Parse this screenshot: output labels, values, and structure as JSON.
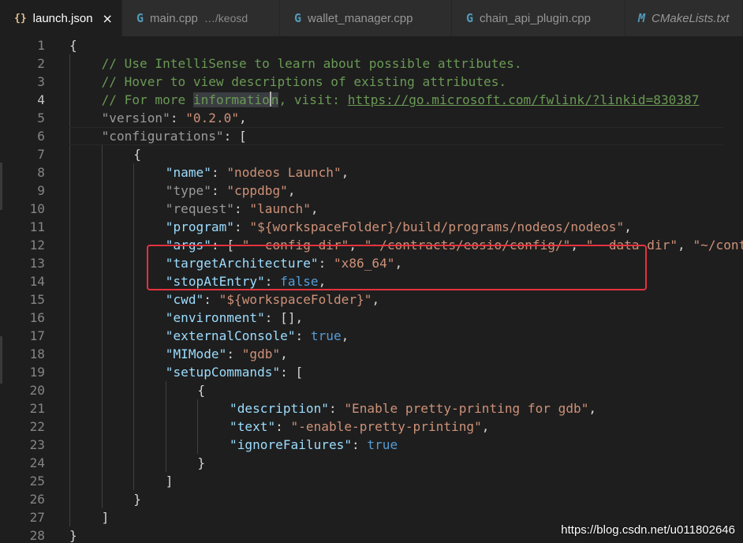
{
  "tabs": [
    {
      "icon": "{}",
      "label": "launch.json",
      "close": "×",
      "active": true
    },
    {
      "icon": "G",
      "label": "main.cpp",
      "description": "…/keosd"
    },
    {
      "icon": "G",
      "label": "wallet_manager.cpp"
    },
    {
      "icon": "G",
      "label": "chain_api_plugin.cpp"
    },
    {
      "icon": "M",
      "label": "CMakeLists.txt"
    }
  ],
  "editor": {
    "line_numbers": [
      "1",
      "2",
      "3",
      "4",
      "5",
      "6",
      "7",
      "8",
      "9",
      "10",
      "11",
      "12",
      "13",
      "14",
      "15",
      "16",
      "17",
      "18",
      "19",
      "20",
      "21",
      "22",
      "23",
      "24",
      "25",
      "26",
      "27",
      "28"
    ],
    "lines": [
      [
        {
          "c": "p",
          "t": "{"
        }
      ],
      [
        {
          "c": "c",
          "t": "// Use IntelliSense to learn about possible attributes."
        }
      ],
      [
        {
          "c": "c",
          "t": "// Hover to view descriptions of existing attributes."
        }
      ],
      [
        {
          "c": "c",
          "t": "// For more "
        },
        {
          "c": "c-hl",
          "t": "informatio"
        },
        {
          "c": "cursor",
          "t": ""
        },
        {
          "c": "c-hl",
          "t": "n"
        },
        {
          "c": "c",
          "t": ", visit: "
        },
        {
          "c": "link",
          "t": "https://go.microsoft.com/fwlink/?linkid=830387"
        }
      ],
      [
        {
          "c": "kd",
          "t": "\"version\""
        },
        {
          "c": "p",
          "t": ": "
        },
        {
          "c": "s",
          "t": "\"0.2.0\""
        },
        {
          "c": "p",
          "t": ","
        }
      ],
      [
        {
          "c": "kd",
          "t": "\"configurations\""
        },
        {
          "c": "p",
          "t": ": ["
        }
      ],
      [
        {
          "c": "p",
          "t": "{"
        }
      ],
      [
        {
          "c": "k",
          "t": "\"name\""
        },
        {
          "c": "p",
          "t": ": "
        },
        {
          "c": "s",
          "t": "\"nodeos Launch\""
        },
        {
          "c": "p",
          "t": ","
        }
      ],
      [
        {
          "c": "kd",
          "t": "\"type\""
        },
        {
          "c": "p",
          "t": ": "
        },
        {
          "c": "s",
          "t": "\"cppdbg\""
        },
        {
          "c": "p",
          "t": ","
        }
      ],
      [
        {
          "c": "kd",
          "t": "\"request\""
        },
        {
          "c": "p",
          "t": ": "
        },
        {
          "c": "s",
          "t": "\"launch\""
        },
        {
          "c": "p",
          "t": ","
        }
      ],
      [
        {
          "c": "k",
          "t": "\"program\""
        },
        {
          "c": "p",
          "t": ": "
        },
        {
          "c": "s",
          "t": "\"${workspaceFolder}/build/programs/nodeos/nodeos\""
        },
        {
          "c": "p",
          "t": ","
        }
      ],
      [
        {
          "c": "k",
          "t": "\"args\""
        },
        {
          "c": "p",
          "t": ": [ "
        },
        {
          "c": "s",
          "t": "\"--config-dir\""
        },
        {
          "c": "p",
          "t": ", "
        },
        {
          "c": "s",
          "t": "\"~/contracts/eosio/config/\""
        },
        {
          "c": "p",
          "t": ", "
        },
        {
          "c": "s",
          "t": "\"--data-dir\""
        },
        {
          "c": "p",
          "t": ", "
        },
        {
          "c": "s",
          "t": "\"~/contracts/eosio/data/\""
        },
        {
          "c": "p",
          "t": " ],"
        }
      ],
      [
        {
          "c": "k",
          "t": "\"targetArchitecture\""
        },
        {
          "c": "p",
          "t": ": "
        },
        {
          "c": "s",
          "t": "\"x86_64\""
        },
        {
          "c": "p",
          "t": ","
        }
      ],
      [
        {
          "c": "k",
          "t": "\"stopAtEntry\""
        },
        {
          "c": "p",
          "t": ": "
        },
        {
          "c": "kw",
          "t": "false"
        },
        {
          "c": "p",
          "t": ","
        }
      ],
      [
        {
          "c": "k",
          "t": "\"cwd\""
        },
        {
          "c": "p",
          "t": ": "
        },
        {
          "c": "s",
          "t": "\"${workspaceFolder}\""
        },
        {
          "c": "p",
          "t": ","
        }
      ],
      [
        {
          "c": "k",
          "t": "\"environment\""
        },
        {
          "c": "p",
          "t": ": [],"
        }
      ],
      [
        {
          "c": "k",
          "t": "\"externalConsole\""
        },
        {
          "c": "p",
          "t": ": "
        },
        {
          "c": "kw",
          "t": "true"
        },
        {
          "c": "p",
          "t": ","
        }
      ],
      [
        {
          "c": "k",
          "t": "\"MIMode\""
        },
        {
          "c": "p",
          "t": ": "
        },
        {
          "c": "s",
          "t": "\"gdb\""
        },
        {
          "c": "p",
          "t": ","
        }
      ],
      [
        {
          "c": "k",
          "t": "\"setupCommands\""
        },
        {
          "c": "p",
          "t": ": ["
        }
      ],
      [
        {
          "c": "p",
          "t": "{"
        }
      ],
      [
        {
          "c": "k",
          "t": "\"description\""
        },
        {
          "c": "p",
          "t": ": "
        },
        {
          "c": "s",
          "t": "\"Enable pretty-printing for gdb\""
        },
        {
          "c": "p",
          "t": ","
        }
      ],
      [
        {
          "c": "k",
          "t": "\"text\""
        },
        {
          "c": "p",
          "t": ": "
        },
        {
          "c": "s",
          "t": "\"-enable-pretty-printing\""
        },
        {
          "c": "p",
          "t": ","
        }
      ],
      [
        {
          "c": "k",
          "t": "\"ignoreFailures\""
        },
        {
          "c": "p",
          "t": ": "
        },
        {
          "c": "kw",
          "t": "true"
        }
      ],
      [
        {
          "c": "p",
          "t": "}"
        }
      ],
      [
        {
          "c": "p",
          "t": "]"
        }
      ],
      [
        {
          "c": "p",
          "t": "}"
        }
      ],
      [
        {
          "c": "p",
          "t": "]"
        }
      ],
      [
        {
          "c": "p",
          "t": "}"
        }
      ]
    ],
    "current_line": 4
  },
  "watermark": "https://blog.csdn.net/u011802646",
  "colors": {
    "background": "#1e1e1e",
    "comment": "#6a9955",
    "key": "#9cdcfe",
    "string": "#ce9178",
    "keyword": "#569cd6",
    "highlight_box": "#e5323f"
  }
}
